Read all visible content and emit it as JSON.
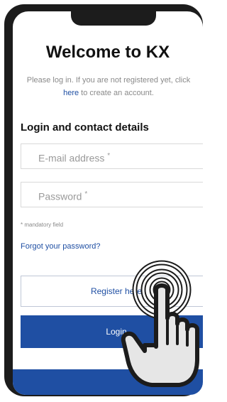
{
  "welcome": {
    "title": "Welcome to KX",
    "intro_text": "Please log in. If you are not registered yet, click",
    "intro_link": "here",
    "intro_tail": "to create an account."
  },
  "form": {
    "section_title": "Login and contact details",
    "email_placeholder": "E-mail address",
    "password_placeholder": "Password",
    "required_marker": "*",
    "mandatory_note": "* mandatory field",
    "forgot_link": "Forgot your password?",
    "register_label": "Register here",
    "login_label": "Login"
  },
  "colors": {
    "primary": "#1f4fa3",
    "frame": "#1c1c1c"
  },
  "icons": {
    "tap_gesture": "hand-tap-icon"
  }
}
